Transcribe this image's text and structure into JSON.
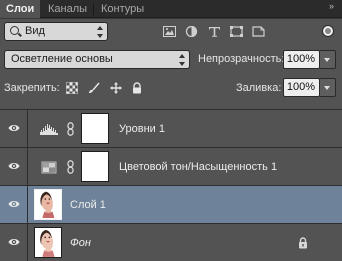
{
  "tabs": [
    {
      "label": "Слои",
      "active": true
    },
    {
      "label": "Каналы",
      "active": false
    },
    {
      "label": "Контуры",
      "active": false
    }
  ],
  "collapse_glyph": "»",
  "filter": {
    "label": "Вид",
    "icons": [
      "image-filter-icon",
      "adjustment-filter-icon",
      "type-filter-icon",
      "shape-filter-icon",
      "smart-object-filter-icon"
    ]
  },
  "blend": {
    "mode": "Осветление основы",
    "opacity_label": "Непрозрачность:",
    "opacity_value": "100%"
  },
  "lock": {
    "label": "Закрепить:",
    "icons": [
      "lock-transparent-pixels-icon",
      "lock-image-pixels-icon",
      "lock-position-icon",
      "lock-all-icon"
    ],
    "fill_label": "Заливка:",
    "fill_value": "100%"
  },
  "layers": [
    {
      "name": "Уровни 1",
      "type": "adjustment",
      "adj_icon": "levels-icon",
      "selected": false,
      "italic": false,
      "locked": false
    },
    {
      "name": "Цветовой тон/Насыщенность 1",
      "type": "adjustment",
      "adj_icon": "hue-saturation-icon",
      "selected": false,
      "italic": false,
      "locked": false
    },
    {
      "name": "Слой 1",
      "type": "pixel",
      "selected": true,
      "italic": false,
      "locked": false
    },
    {
      "name": "Фон",
      "type": "pixel",
      "selected": false,
      "italic": true,
      "locked": true
    }
  ],
  "colors": {
    "panel_bg": "#535353",
    "selected_row": "#6e8399",
    "tabbar_bg": "#2b2b2b"
  }
}
